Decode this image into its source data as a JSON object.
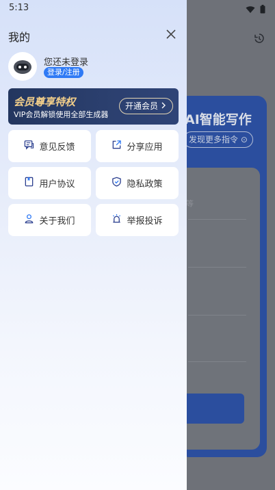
{
  "status_bar": {
    "time": "5:13"
  },
  "drawer": {
    "title": "我的",
    "user": {
      "status": "您还未登录",
      "login_label": "登录/注册"
    },
    "vip": {
      "title": "会员尊享特权",
      "subtitle": "VIP会员解锁使用全部生成器",
      "button_label": "开通会员"
    },
    "menu": [
      {
        "label": "意见反馈",
        "icon": "feedback-icon"
      },
      {
        "label": "分享应用",
        "icon": "share-icon"
      },
      {
        "label": "用户协议",
        "icon": "agreement-icon"
      },
      {
        "label": "隐私政策",
        "icon": "shield-icon"
      },
      {
        "label": "关于我们",
        "icon": "person-icon"
      },
      {
        "label": "举报投诉",
        "icon": "alarm-icon"
      }
    ]
  },
  "background": {
    "title": "AI智能写作",
    "pill": "发现更多指令",
    "hint": "等"
  },
  "colors": {
    "accent": "#2f7af5",
    "vip_gold": "#f3cf8a",
    "vip_bg": "#23365f"
  }
}
